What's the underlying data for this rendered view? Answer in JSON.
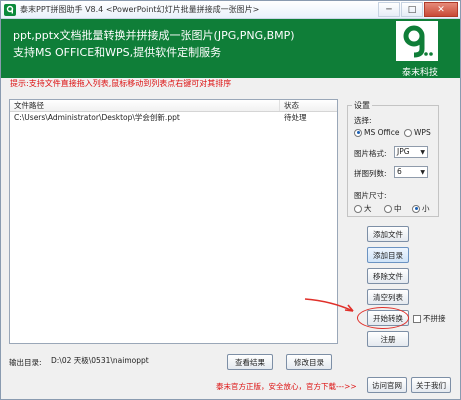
{
  "window": {
    "title": "泰末PPT拼图助手 V8.4 <PowerPoint幻灯片批量拼接成一张图片>"
  },
  "banner": {
    "line1": "ppt,pptx文档批量转换并拼接成一张图片(JPG,PNG,BMP)",
    "line2": "支持MS OFFICE和WPS,提供软件定制服务",
    "logo_text": "泰末科技"
  },
  "hint": "提示:支持文件直接拖入列表,鼠标移动到列表点右键可对其排序",
  "table": {
    "columns": [
      "文件路径",
      "状态"
    ],
    "rows": [
      {
        "path": "C:\\Users\\Administrator\\Desktop\\学会创新.ppt",
        "status": "待处理"
      }
    ]
  },
  "settings": {
    "legend": "设置",
    "engine_label": "选择:",
    "engine_options": [
      {
        "label": "MS Office",
        "selected": true
      },
      {
        "label": "WPS",
        "selected": false
      }
    ],
    "format_label": "图片格式:",
    "format_value": "JPG",
    "columns_label": "拼图列数:",
    "columns_value": "6",
    "size_label": "图片尺寸:",
    "size_options": [
      {
        "label": "大",
        "selected": false
      },
      {
        "label": "中",
        "selected": false
      },
      {
        "label": "小",
        "selected": true
      }
    ]
  },
  "buttons": {
    "add_file": "添加文件",
    "add_folder": "添加目录",
    "remove_file": "移除文件",
    "clear_list": "清空列表",
    "start": "开始转换",
    "no_stitch": "不拼接",
    "register": "注册",
    "view_result": "查看结果",
    "change_dir": "修改目录",
    "visit_site": "访问官网",
    "about": "关于我们"
  },
  "output": {
    "label": "输出目录:",
    "path": "D:\\02 天极\\0531\\naimoppt"
  },
  "footer": {
    "text": "泰末官方正版，安全放心，官方下载",
    "arrows": "--->>"
  },
  "colors": {
    "brand_green": "#0f7e38",
    "hint_red": "#d11111"
  }
}
